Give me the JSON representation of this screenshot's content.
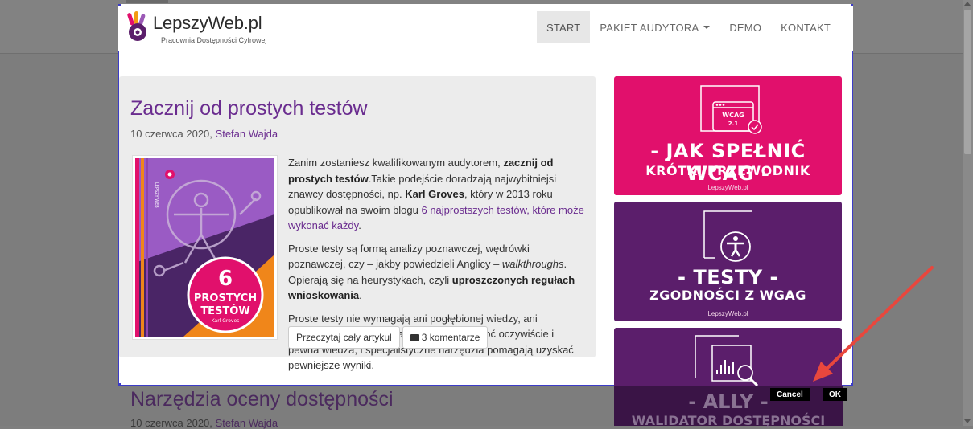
{
  "site": {
    "logo_title": "LepszyWeb.pl",
    "logo_subtitle": "Pracownia Dostępności Cyfrowej"
  },
  "nav": {
    "items": [
      {
        "label": "START",
        "active": true
      },
      {
        "label": "PAKIET AUDYTORA",
        "dropdown": true
      },
      {
        "label": "DEMO"
      },
      {
        "label": "KONTAKT"
      }
    ]
  },
  "article": {
    "title": "Zacznij od prostych testów",
    "date": "10 czerwca 2020,",
    "author": "Stefan Wajda",
    "thumb": {
      "number": "6",
      "line1": "PROSTYCH",
      "line2": "TESTÓW",
      "author": "Karl Groves",
      "spine": "LEPSZY WEB"
    },
    "p1": {
      "t1": "Zanim zostaniesz kwalifikowanym audytorem, ",
      "b1": "zacznij od prostych testów",
      "t2": ".Takie podejście doradzają najwybitniejsi znawcy dostępności, np. ",
      "b2": "Karl Groves",
      "t3": ", który w 2013 roku opublikował na swoim blogu ",
      "link": "6 najprostszych testów, które może wykonać każdy",
      "t4": "."
    },
    "p2": {
      "t1": "Proste testy są formą analizy poznawczej, wędrówki poznawczej, czy – jakby powiedzieli Anglicy – ",
      "i1": "walkthroughs",
      "t2": ". Opierają się na heurystykach, czyli ",
      "b1": "uproszczonych regułach wnioskowania",
      "t3": "."
    },
    "p3": "Proste testy nie wymagają ani pogłębionej wiedzy, ani stosowania skomplikowanych narzędzi, choć oczywiście i pewna wiedza, i specjalistyczne narzędzia pomagają uzyskać pewniejsze wyniki.",
    "read_more": "Przeczytaj cały artykuł",
    "comments": "3 komentarze"
  },
  "banners": [
    {
      "badge_top": "WCAG",
      "badge_bottom": "2.1",
      "line1": "- JAK SPEŁNIĆ WCAG -",
      "line2": "KRÓTKI PRZEWODNIK",
      "site": "LepszyWeb.pl",
      "color": "#e1106c"
    },
    {
      "line1": "- TESTY -",
      "line2": "ZGODNOŚCI Z WGAG",
      "site": "LepszyWeb.pl",
      "color": "#5b1e6b"
    },
    {
      "line1": "- ALLY -",
      "line2": "WALIDATOR DOSTĘPNOŚCI",
      "color": "#5b1e6b"
    }
  ],
  "post2": {
    "title": "Narzędzia oceny dostępności",
    "date": "10 czerwca 2020,",
    "author": "Stefan Wajda"
  },
  "capture": {
    "cancel": "Cancel",
    "ok": "OK",
    "selection_color": "#3c3cc8",
    "arrow_color": "#e8473d"
  }
}
